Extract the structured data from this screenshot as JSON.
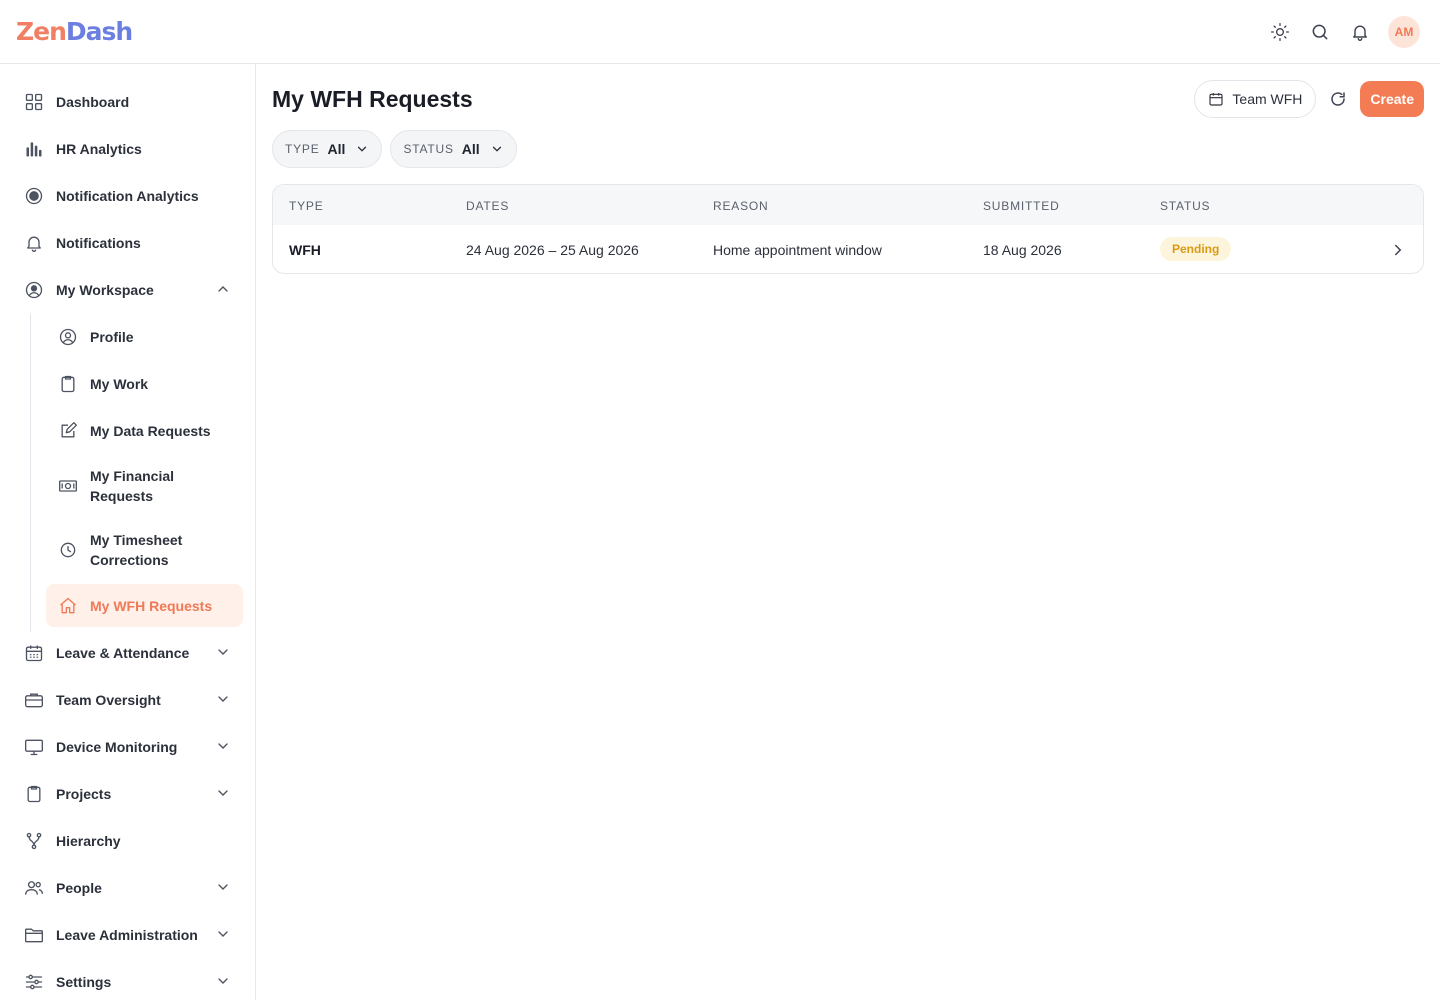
{
  "app": {
    "logo_part1": "Zen",
    "logo_part2": "Dash",
    "avatar_initials": "AM",
    "colors": {
      "accent": "#f47c55",
      "accent_soft": "#fff0ea",
      "pending_bg": "#fdf4dc",
      "pending_text": "#d99a16"
    }
  },
  "topbar": {
    "icons": [
      "sun-icon",
      "search-icon",
      "bell-icon"
    ]
  },
  "sidebar": {
    "items": [
      {
        "label": "Dashboard",
        "icon": "grid-icon"
      },
      {
        "label": "HR Analytics",
        "icon": "bar-chart-icon"
      },
      {
        "label": "Notification Analytics",
        "icon": "radar-icon"
      },
      {
        "label": "Notifications",
        "icon": "bell-icon"
      },
      {
        "label": "My Workspace",
        "icon": "user-circle-icon",
        "expanded": true
      },
      {
        "label": "Leave & Attendance",
        "icon": "calendar-icon"
      },
      {
        "label": "Team Oversight",
        "icon": "briefcase-icon"
      },
      {
        "label": "Device Monitoring",
        "icon": "monitor-icon"
      },
      {
        "label": "Projects",
        "icon": "clipboard-icon"
      },
      {
        "label": "Hierarchy",
        "icon": "hierarchy-icon"
      },
      {
        "label": "People",
        "icon": "people-icon"
      },
      {
        "label": "Leave Administration",
        "icon": "folder-icon"
      },
      {
        "label": "Settings",
        "icon": "sliders-icon"
      }
    ],
    "sub_items": [
      {
        "label": "Profile",
        "icon": "user-circle-icon"
      },
      {
        "label": "My Work",
        "icon": "clipboard-icon"
      },
      {
        "label": "My Data Requests",
        "icon": "edit-icon"
      },
      {
        "label": "My Financial Requests",
        "icon": "money-icon"
      },
      {
        "label": "My Timesheet Corrections",
        "icon": "clock-icon"
      },
      {
        "label": "My WFH Requests",
        "icon": "home-icon",
        "active": true
      }
    ]
  },
  "main": {
    "title": "My WFH Requests",
    "team_wfh_label": "Team WFH",
    "create_label": "Create",
    "filters": [
      {
        "label": "TYPE",
        "value": "All"
      },
      {
        "label": "STATUS",
        "value": "All"
      }
    ],
    "table": {
      "columns": [
        "TYPE",
        "DATES",
        "REASON",
        "SUBMITTED",
        "STATUS"
      ],
      "rows": [
        {
          "type": "WFH",
          "dates": "24 Aug 2026 – 25 Aug 2026",
          "reason": "Home appointment window",
          "submitted": "18 Aug 2026",
          "status": "Pending"
        }
      ]
    }
  }
}
